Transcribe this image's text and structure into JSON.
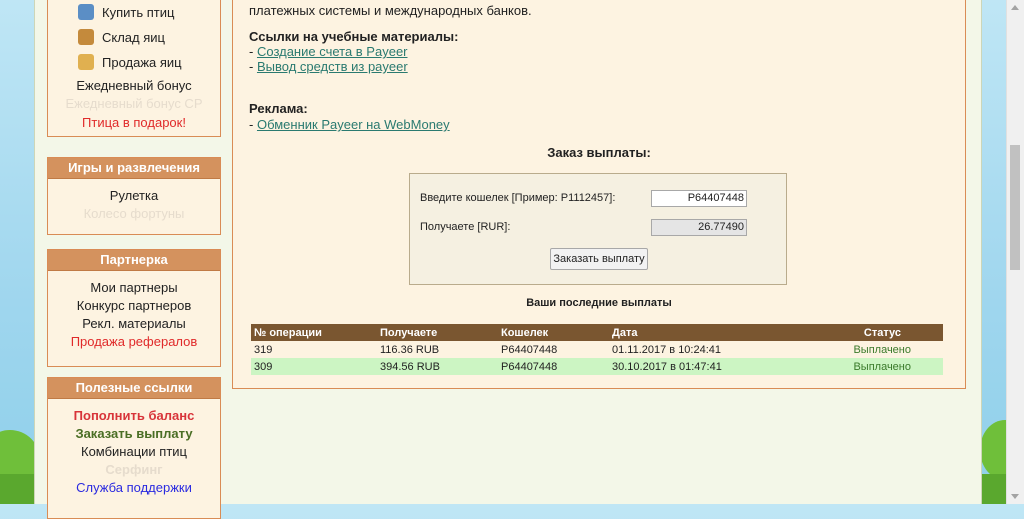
{
  "sidebar": {
    "top_menu": {
      "buy_birds": "Купить птиц",
      "egg_storage": "Склад яиц",
      "sell_eggs": "Продажа яиц",
      "daily_bonus": "Ежедневный бонус",
      "daily_bonus_cp": "Ежедневный бонус СР",
      "gift_bird": "Птица в подарок!"
    },
    "games": {
      "title": "Игры и развлечения",
      "items": [
        "Рулетка",
        "Колесо фортуны"
      ]
    },
    "partners": {
      "title": "Партнерка",
      "items": [
        "Мои партнеры",
        "Конкурс партнеров",
        "Рекл. материалы",
        "Продажа рефералов"
      ]
    },
    "links": {
      "title": "Полезные ссылки",
      "items": [
        "Пополнить баланс",
        "Заказать выплату",
        "Комбинации птиц",
        "Серфинг",
        "Служба поддержки"
      ]
    }
  },
  "main": {
    "intro_text": "платежных системы и международных банков.",
    "materials_title": "Ссылки на учебные материалы:",
    "material_links": [
      "Создание счета в Payeer",
      "Вывод средств из payeer"
    ],
    "ads_title": "Реклама:",
    "ad_links": [
      "Обменник Payeer на WebMoney"
    ],
    "dash": "-",
    "order": {
      "title": "Заказ выплаты:",
      "wallet_label": "Введите кошелек [Пример: P1112457]:",
      "wallet_value": "P64407448",
      "receive_label": "Получаете [RUR]:",
      "receive_value": "26.77490",
      "submit_label": "Заказать выплату"
    },
    "payouts": {
      "title": "Ваши последние выплаты",
      "columns": [
        "№ операции",
        "Получаете",
        "Кошелек",
        "Дата",
        "Статус"
      ],
      "rows": [
        [
          "319",
          "116.36 RUB",
          "P64407448",
          "01.11.2017 в 10:24:41",
          "Выплачено"
        ],
        [
          "309",
          "394.56 RUB",
          "P64407448",
          "30.10.2017 в 01:47:41",
          "Выплачено"
        ]
      ]
    }
  }
}
